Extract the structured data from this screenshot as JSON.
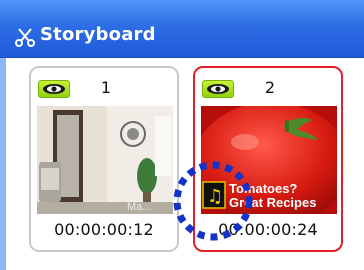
{
  "window": {
    "title": "Storyboard",
    "icon": "scissors-icon"
  },
  "clips": [
    {
      "number": "1",
      "timecode": "00:00:00:12",
      "visible": true,
      "selected": false,
      "watermark": "Ma..."
    },
    {
      "number": "2",
      "timecode": "00:00:00:24",
      "visible": true,
      "selected": true,
      "overlay_line1": "Tomatoes?",
      "overlay_line2": "Great Recipes",
      "overlay_icon": "music-note-icon"
    }
  ],
  "colors": {
    "titlebar": "#2f6fe6",
    "selected_border": "#e0202a",
    "eye_badge": "#a8e01a",
    "drop_indicator": "#1432c8"
  }
}
